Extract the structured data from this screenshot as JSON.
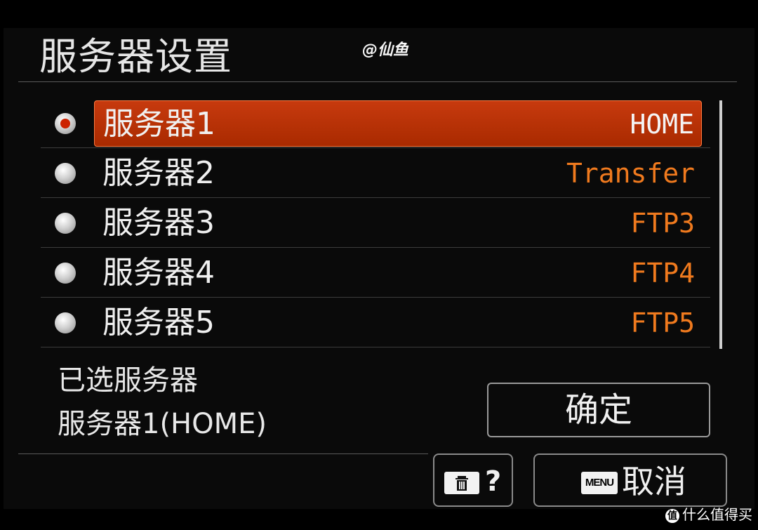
{
  "page": {
    "title": "服务器设置",
    "watermark": "@仙鱼"
  },
  "servers": [
    {
      "name": "服务器1",
      "tag": "HOME",
      "selected": true
    },
    {
      "name": "服务器2",
      "tag": "Transfer",
      "selected": false
    },
    {
      "name": "服务器3",
      "tag": "FTP3",
      "selected": false
    },
    {
      "name": "服务器4",
      "tag": "FTP4",
      "selected": false
    },
    {
      "name": "服务器5",
      "tag": "FTP5",
      "selected": false
    }
  ],
  "selection": {
    "label": "已选服务器",
    "value": "服务器1(HOME)"
  },
  "buttons": {
    "ok": "确定",
    "help": "?",
    "menu_badge": "MENU",
    "cancel": "取消"
  },
  "brand": {
    "icon": "值",
    "text": "什么值得买"
  },
  "colors": {
    "selected_row": "#b83200",
    "tag": "#f07a1e",
    "radio_dot": "#cc2200"
  }
}
